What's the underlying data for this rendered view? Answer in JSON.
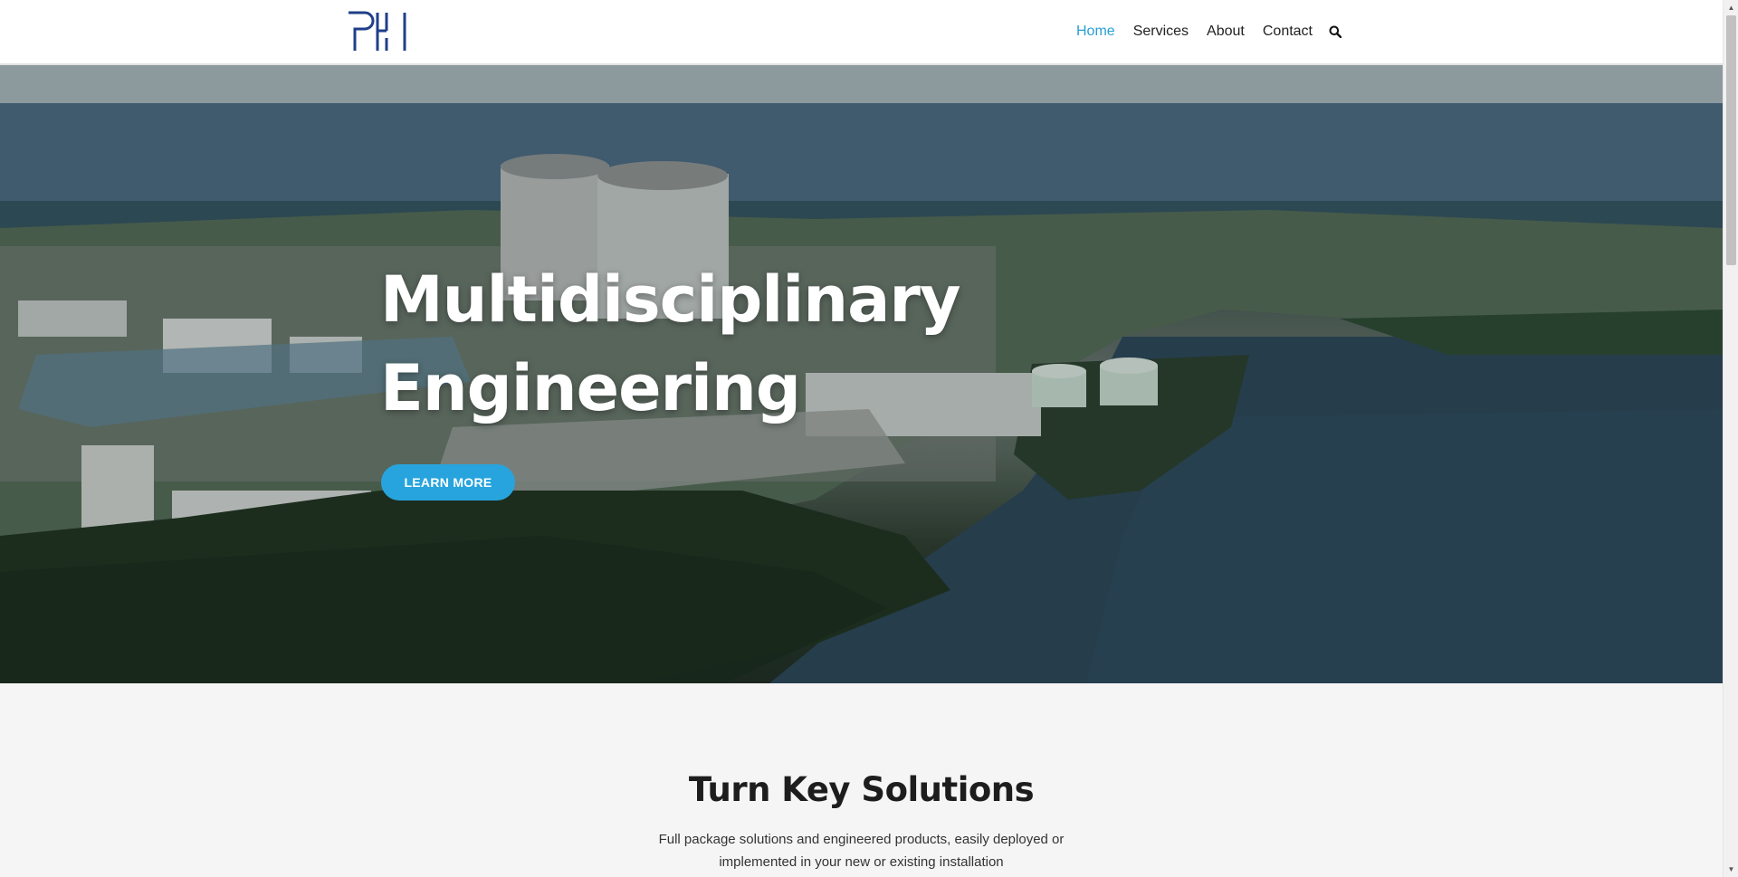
{
  "header": {
    "logo_text": "PH",
    "nav": [
      {
        "label": "Home",
        "active": true
      },
      {
        "label": "Services",
        "active": false
      },
      {
        "label": "About",
        "active": false
      },
      {
        "label": "Contact",
        "active": false
      }
    ],
    "search_icon": "search-icon"
  },
  "hero": {
    "title_line1": "Multidisciplinary",
    "title_line2": "Engineering",
    "button_label": "LEARN MORE"
  },
  "section": {
    "title": "Turn Key Solutions",
    "text": "Full package solutions and engineered products, easily deployed or implemented in your new or existing installation"
  },
  "colors": {
    "accent": "#2a9fd6",
    "button": "#27a4dd",
    "logo": "#1f3f8a"
  }
}
